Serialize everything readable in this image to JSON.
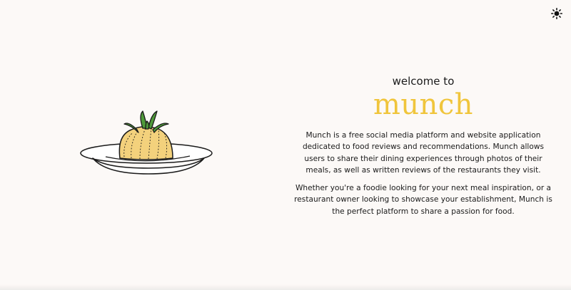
{
  "header": {
    "theme_toggle_icon": "sun-icon"
  },
  "hero": {
    "welcome": "welcome to",
    "brand": "munch",
    "brand_color": "#f0c53c",
    "paragraph_1": "Munch is a free social media platform and website application dedicated to food reviews and recommendations. Munch allows users to share their dining experiences through photos of their meals, as well as written reviews of the restaurants they visit.",
    "paragraph_2": "Whether you're a foodie looking for your next meal inspiration, or a restaurant owner looking to showcase your establishment, Munch is the perfect platform to share a passion for food.",
    "illustration_icon": "onion-on-plate-illustration"
  }
}
